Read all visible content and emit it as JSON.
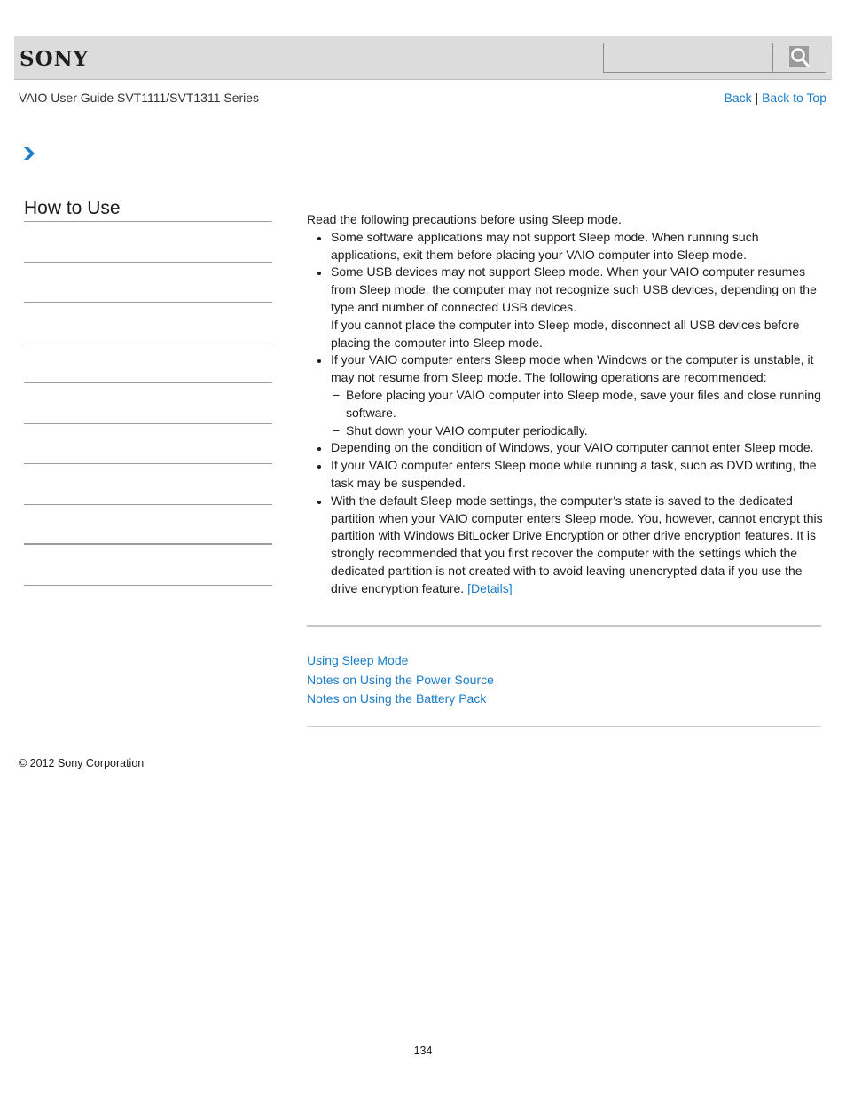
{
  "header": {
    "logo": "SONY",
    "search": {
      "placeholder": "",
      "value": "",
      "button_icon": "search-icon"
    }
  },
  "nav": {
    "guide_title": "VAIO User Guide SVT1111/SVT1311 Series",
    "back_label": "Back",
    "separator": "|",
    "back_to_top_label": "Back to Top",
    "breadcrumb_icon": "chevron-right-icon"
  },
  "sidebar": {
    "title": "How to Use",
    "items": [
      {
        "label": ""
      },
      {
        "label": ""
      },
      {
        "label": ""
      },
      {
        "label": ""
      },
      {
        "label": ""
      },
      {
        "label": ""
      },
      {
        "label": ""
      },
      {
        "label": ""
      },
      {
        "label": ""
      }
    ]
  },
  "main": {
    "intro": "Read the following precautions before using Sleep mode.",
    "bullets": [
      {
        "text": "Some software applications may not support Sleep mode. When running such applications, exit them before placing your VAIO computer into Sleep mode."
      },
      {
        "text": "Some USB devices may not support Sleep mode. When your VAIO computer resumes from Sleep mode, the computer may not recognize such USB devices, depending on the type and number of connected USB devices.",
        "extra": "If you cannot place the computer into Sleep mode, disconnect all USB devices before placing the computer into Sleep mode."
      },
      {
        "text": "If your VAIO computer enters Sleep mode when Windows or the computer is unstable, it may not resume from Sleep mode. The following operations are recommended:",
        "subitems": [
          "Before placing your VAIO computer into Sleep mode, save your files and close running software.",
          "Shut down your VAIO computer periodically."
        ]
      },
      {
        "text": "Depending on the condition of Windows, your VAIO computer cannot enter Sleep mode."
      },
      {
        "text": "If your VAIO computer enters Sleep mode while running a task, such as DVD writing, the task may be suspended."
      },
      {
        "text": "With the default Sleep mode settings, the computer’s state is saved to the dedicated partition when your VAIO computer enters Sleep mode. You, however, cannot encrypt this partition with Windows BitLocker Drive Encryption or other drive encryption features. It is strongly recommended that you first recover the computer with the settings which the dedicated partition is not created with to avoid leaving unencrypted data if you use the drive encryption feature.",
        "link": "[Details]"
      }
    ]
  },
  "related_links": [
    "Using Sleep Mode",
    "Notes on Using the Power Source",
    "Notes on Using the Battery Pack"
  ],
  "footer": {
    "copyright": "© 2012 Sony Corporation",
    "page_number": "134"
  },
  "colors": {
    "link": "#1a7bc7",
    "header_bg": "#dcdcdc",
    "divider": "#9b9b9b"
  }
}
